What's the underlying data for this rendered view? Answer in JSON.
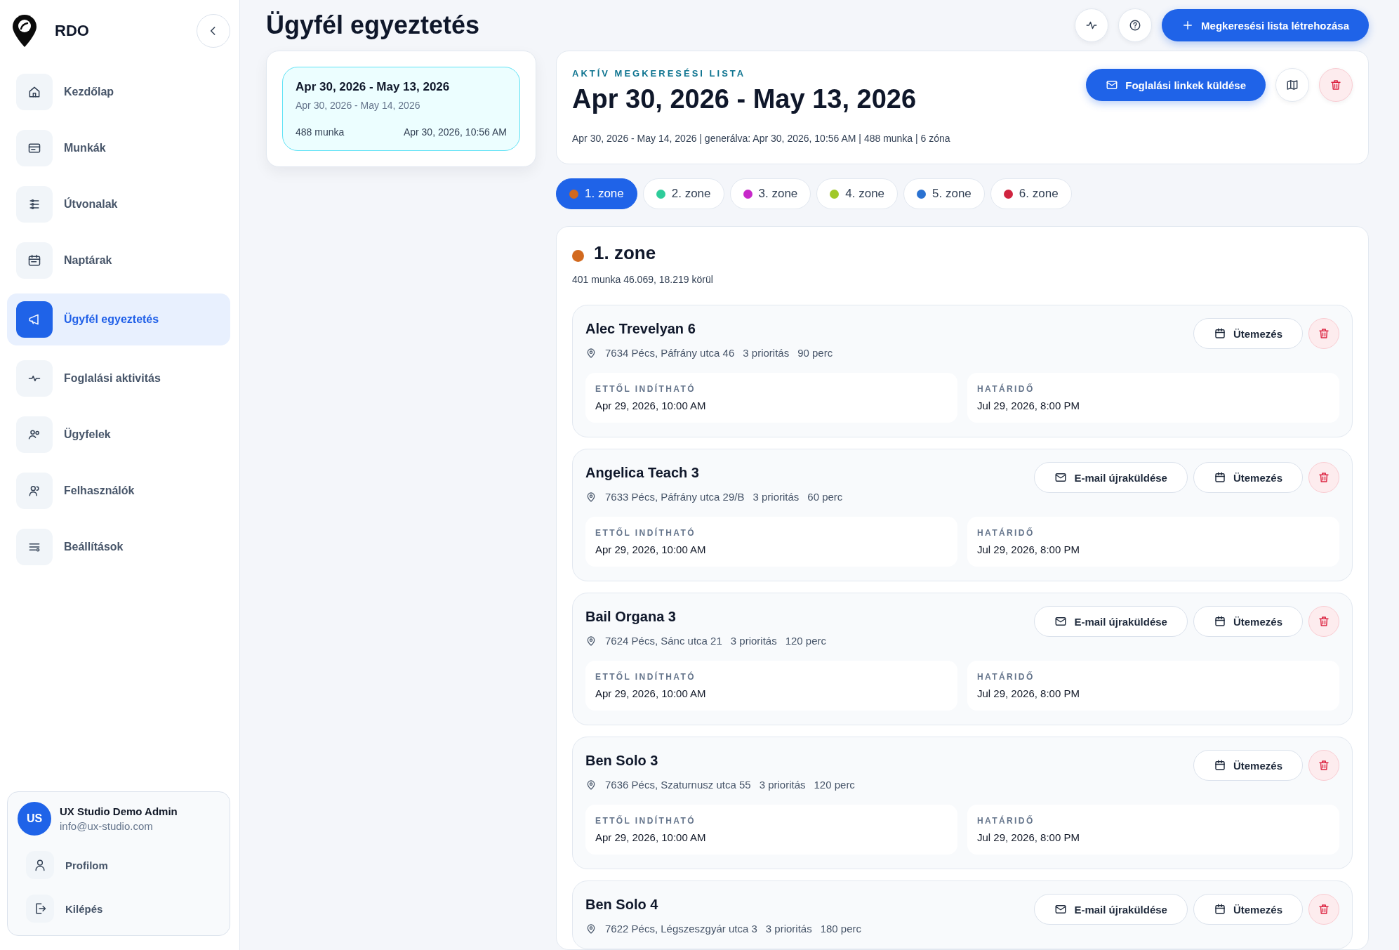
{
  "app": {
    "name": "RDO"
  },
  "sidebar": {
    "items": [
      {
        "label": "Kezdőlap",
        "selected": false
      },
      {
        "label": "Munkák",
        "selected": false
      },
      {
        "label": "Útvonalak",
        "selected": false
      },
      {
        "label": "Naptárak",
        "selected": false
      },
      {
        "label": "Ügyfél egyeztetés",
        "selected": true
      },
      {
        "label": "Foglalási aktivitás",
        "selected": false
      },
      {
        "label": "Ügyfelek",
        "selected": false
      },
      {
        "label": "Felhasználók",
        "selected": false
      },
      {
        "label": "Beállítások",
        "selected": false
      }
    ]
  },
  "user": {
    "initials": "US",
    "name": "UX Studio Demo Admin",
    "email": "info@ux-studio.com",
    "links": [
      {
        "label": "Profilom"
      },
      {
        "label": "Kilépés"
      }
    ]
  },
  "page": {
    "title": "Ügyfél egyeztetés",
    "create_button": "Megkeresési lista létrehozása"
  },
  "lists": [
    {
      "title": "Apr 30, 2026 - May 13, 2026",
      "range": "Apr 30, 2026 - May 14, 2026",
      "count": "488 munka",
      "generated": "Apr 30, 2026, 10:56 AM",
      "selected": true
    }
  ],
  "active_list": {
    "label": "AKTÍV MEGKERESÉSI LISTA",
    "title": "Apr 30, 2026 - May 13, 2026",
    "meta": "Apr 30, 2026 - May 14, 2026 | generálva: Apr 30, 2026, 10:56 AM | 488 munka | 6 zóna",
    "send_button": "Foglalási linkek küldése"
  },
  "zones": [
    {
      "label": "1. zone",
      "color": "#d2691e",
      "selected": true
    },
    {
      "label": "2. zone",
      "color": "#2ecc9a",
      "selected": false
    },
    {
      "label": "3. zone",
      "color": "#c728c9",
      "selected": false
    },
    {
      "label": "4. zone",
      "color": "#a0c828",
      "selected": false
    },
    {
      "label": "5. zone",
      "color": "#2b72d1",
      "selected": false
    },
    {
      "label": "6. zone",
      "color": "#d0243f",
      "selected": false
    }
  ],
  "zone_panel": {
    "title": "1. zone",
    "color": "#d2691e",
    "summary": "401 munka 46.069, 18.219 körül",
    "jobs": [
      {
        "name": "Alec Trevelyan 6",
        "address": "7634 Pécs, Páfrány utca 46",
        "priority": "3 prioritás",
        "duration": "90 perc",
        "actions": [
          {
            "kind": "schedule",
            "label": "Ütemezés"
          },
          {
            "kind": "delete"
          }
        ],
        "fields": [
          {
            "label": "ETTŐL INDÍTHATÓ",
            "value": "Apr 29, 2026, 10:00 AM"
          },
          {
            "label": "HATÁRIDŐ",
            "value": "Jul 29, 2026, 8:00 PM"
          }
        ]
      },
      {
        "name": "Angelica Teach 3",
        "address": "7633 Pécs, Páfrány utca 29/B",
        "priority": "3 prioritás",
        "duration": "60 perc",
        "actions": [
          {
            "kind": "resend",
            "label": "E-mail újraküldése"
          },
          {
            "kind": "schedule",
            "label": "Ütemezés"
          },
          {
            "kind": "delete"
          }
        ],
        "fields": [
          {
            "label": "ETTŐL INDÍTHATÓ",
            "value": "Apr 29, 2026, 10:00 AM"
          },
          {
            "label": "HATÁRIDŐ",
            "value": "Jul 29, 2026, 8:00 PM"
          }
        ]
      },
      {
        "name": "Bail Organa 3",
        "address": "7624 Pécs, Sánc utca 21",
        "priority": "3 prioritás",
        "duration": "120 perc",
        "actions": [
          {
            "kind": "resend",
            "label": "E-mail újraküldése"
          },
          {
            "kind": "schedule",
            "label": "Ütemezés"
          },
          {
            "kind": "delete"
          }
        ],
        "fields": [
          {
            "label": "ETTŐL INDÍTHATÓ",
            "value": "Apr 29, 2026, 10:00 AM"
          },
          {
            "label": "HATÁRIDŐ",
            "value": "Jul 29, 2026, 8:00 PM"
          }
        ]
      },
      {
        "name": "Ben Solo 3",
        "address": "7636 Pécs, Szaturnusz utca 55",
        "priority": "3 prioritás",
        "duration": "120 perc",
        "actions": [
          {
            "kind": "schedule",
            "label": "Ütemezés"
          },
          {
            "kind": "delete"
          }
        ],
        "fields": [
          {
            "label": "ETTŐL INDÍTHATÓ",
            "value": "Apr 29, 2026, 10:00 AM"
          },
          {
            "label": "HATÁRIDŐ",
            "value": "Jul 29, 2026, 8:00 PM"
          }
        ]
      },
      {
        "name": "Ben Solo 4",
        "address": "7622 Pécs, Légszeszgyár utca 3",
        "priority": "3 prioritás",
        "duration": "180 perc",
        "actions": [
          {
            "kind": "resend",
            "label": "E-mail újraküldése"
          },
          {
            "kind": "schedule",
            "label": "Ütemezés"
          },
          {
            "kind": "delete"
          }
        ]
      }
    ]
  }
}
